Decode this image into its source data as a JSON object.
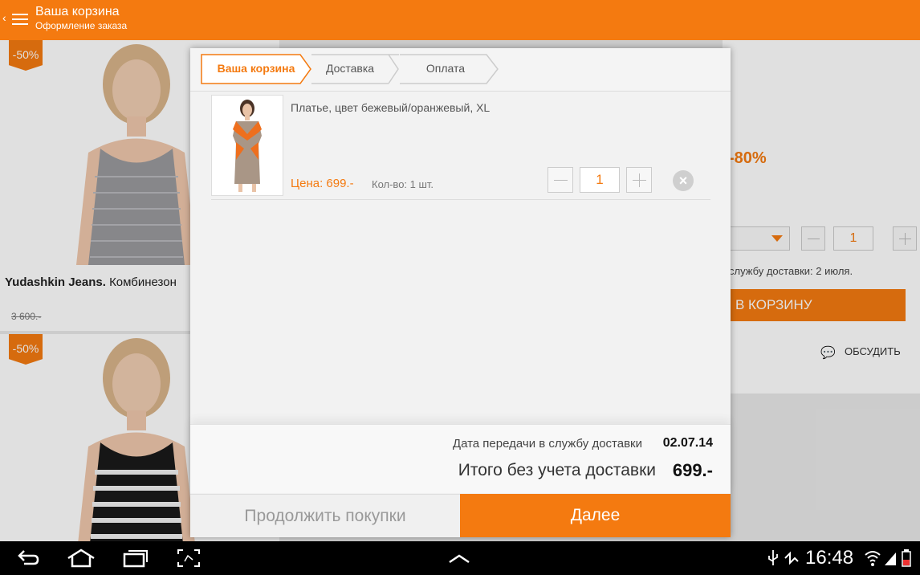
{
  "actionbar": {
    "title": "Ваша корзина",
    "subtitle": "Оформление заказа"
  },
  "background": {
    "badge_1": "-50%",
    "badge_2": "-50%",
    "product_brand": "Yudashkin Jeans.",
    "product_name": "Комбинезон",
    "old_price": "3 600.-",
    "discount": "-80%",
    "qty": "1",
    "shipping_text": "службу доставки: 2 июля.",
    "cart_button": "В КОРЗИНУ",
    "discuss": "ОБСУДИТЬ"
  },
  "dialog": {
    "steps": [
      {
        "label": "Ваша корзина",
        "active": true
      },
      {
        "label": "Доставка",
        "active": false
      },
      {
        "label": "Оплата",
        "active": false
      }
    ],
    "item": {
      "title": "Платье, цвет бежевый/оранжевый, XL",
      "price": "Цена: 699.-",
      "qty_label": "Кол-во: 1 шт.",
      "qty": "1"
    },
    "summary": {
      "date_label": "Дата передачи в службу доставки",
      "date": "02.07.14",
      "total_label": "Итого без учета доставки",
      "total": "699.-"
    },
    "continue_button": "Продолжить покупки",
    "next_button": "Далее"
  },
  "statusbar": {
    "time": "16:48"
  },
  "colors": {
    "accent": "#f47a10"
  }
}
